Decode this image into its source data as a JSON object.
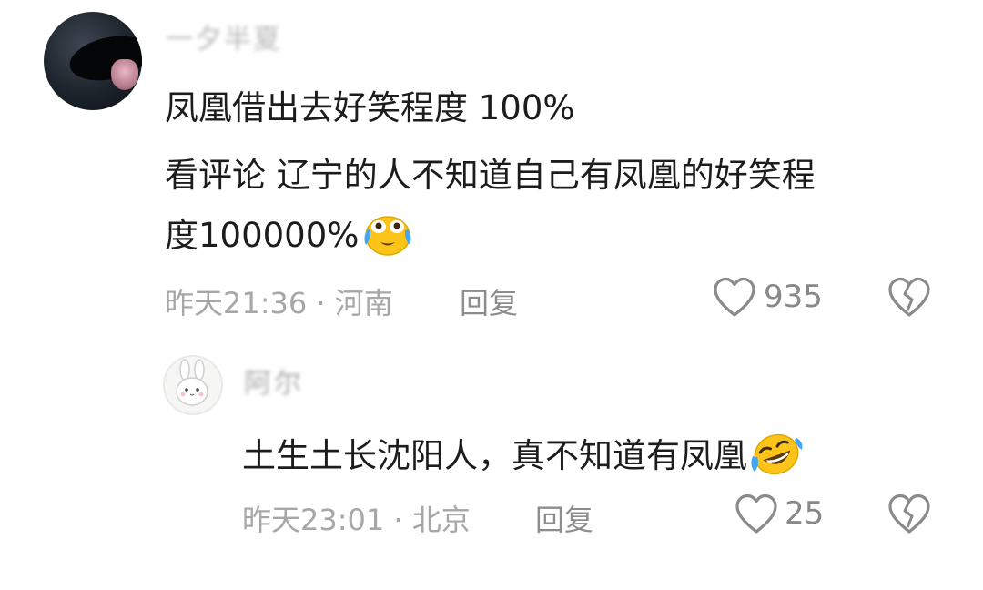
{
  "comment": {
    "username": "一夕半夏",
    "text_line1": "凤凰借出去好笑程度 100%",
    "text_line2": "看评论 辽宁的人不知道自己有凤凰的好笑程",
    "text_line3": "度100000%",
    "emoji_icon": "crying-laughing-face-icon",
    "time_location": "昨天21:36 · 河南",
    "reply_label": "回复",
    "like_count": "935"
  },
  "reply": {
    "username": "阿尔",
    "text": "土生土长沈阳人，真不知道有凤凰",
    "emoji_icon": "rolling-laughing-face-icon",
    "time_location": "昨天23:01 · 北京",
    "reply_label": "回复",
    "like_count": "25"
  },
  "colors": {
    "text": "#1c1c1c",
    "meta": "#a7a7a7",
    "icon": "#8a8a8a",
    "emoji": "#fcc419"
  }
}
